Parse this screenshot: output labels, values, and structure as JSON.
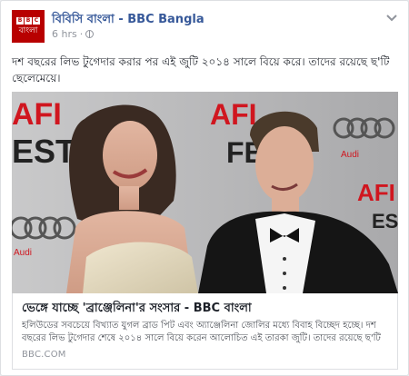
{
  "post": {
    "page_name": "বিবিসি বাংলা - BBC Bangla",
    "avatar_top": [
      "B",
      "B",
      "C"
    ],
    "avatar_bottom": "বাংলা",
    "time": "6 hrs",
    "separator": "·",
    "options_icon": "chevron-down-icon",
    "text": "দশ বছরের লিভ টুগেদার করার পর এই জুটি ২০১৪ সালে বিয়ে করে। তাদের রয়েছে ছ'টি ছেলেমেয়ে।"
  },
  "photo": {
    "backdrop_text_left_1": "AFI",
    "backdrop_text_left_2": "EST",
    "backdrop_text_right_1": "AFI",
    "backdrop_text_right_2": "FEST",
    "backdrop_text_far_right_1": "AFI",
    "backdrop_text_far_right_2": "EST",
    "audi_label": "Audi"
  },
  "link": {
    "title": "ভেঙ্গে যাচ্ছে 'ব্রাঞ্জেলিনা'র সংসার - BBC বাংলা",
    "description": "হলিউডের সবচেয়ে বিখ্যাত যুগল ব্রাড পিট এবং অ্যাঞ্জেলিনা জোলির মধ্যে বিবাহ বিচ্ছেদ হচ্ছে। দশ বছরের লিভ টুগেদার শেষে ২০১৪ সালে বিয়ে করেন আলোচিত এই তারকা জুটি। তাদের রয়েছে ছ'টি সন্তান।",
    "domain": "BBC.COM"
  }
}
